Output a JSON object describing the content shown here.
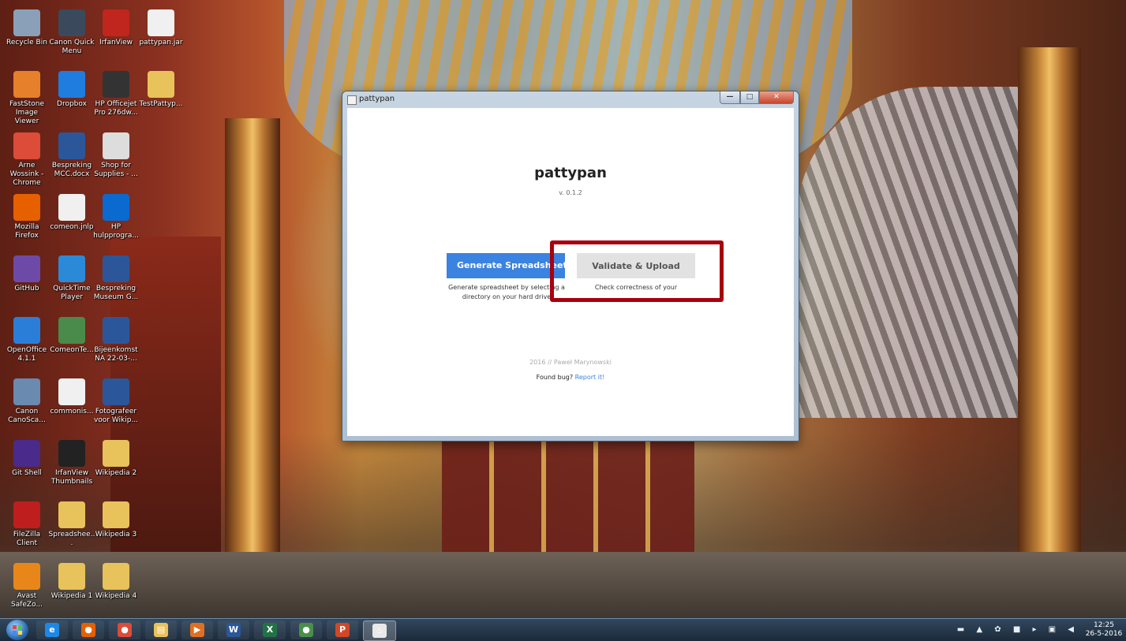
{
  "desktop": {
    "icons": [
      {
        "label": "Recycle Bin",
        "icon": "recycle-bin-icon",
        "color": "#8aa0b8"
      },
      {
        "label": "Canon Quick Menu",
        "icon": "canon-quick-menu-icon",
        "color": "#3a4a5c"
      },
      {
        "label": "IrfanView",
        "icon": "irfanview-icon",
        "color": "#c0261e"
      },
      {
        "label": "pattypan.jar",
        "icon": "java-jar-icon",
        "color": "#f0f0f0"
      },
      {
        "label": "FastStone Image Viewer",
        "icon": "faststone-icon",
        "color": "#e6802a"
      },
      {
        "label": "Dropbox",
        "icon": "dropbox-icon",
        "color": "#1f7de0"
      },
      {
        "label": "HP Officejet Pro 276dw...",
        "icon": "printer-icon",
        "color": "#333333"
      },
      {
        "label": "TestPattyp...",
        "icon": "folder-icon",
        "color": "#e8c25a"
      },
      {
        "label": "Arne Wossink - Chrome",
        "icon": "chrome-icon",
        "color": "#dd4b39"
      },
      {
        "label": "Bespreking MCC.docx",
        "icon": "word-doc-icon",
        "color": "#2b579a"
      },
      {
        "label": "Shop for Supplies - ...",
        "icon": "printer-shop-icon",
        "color": "#dddddd"
      },
      {
        "label": "Mozilla Firefox",
        "icon": "firefox-icon",
        "color": "#e66000"
      },
      {
        "label": "comeon.jnlp",
        "icon": "java-icon",
        "color": "#f0f0f0"
      },
      {
        "label": "HP hulpprogra...",
        "icon": "hp-icon",
        "color": "#0a6ad0"
      },
      {
        "label": "GitHub",
        "icon": "github-icon",
        "color": "#6e4aa8"
      },
      {
        "label": "QuickTime Player",
        "icon": "quicktime-icon",
        "color": "#2a8ad8"
      },
      {
        "label": "Bespreking Museum G...",
        "icon": "word-doc-icon",
        "color": "#2b579a"
      },
      {
        "label": "OpenOffice 4.1.1",
        "icon": "openoffice-icon",
        "color": "#2a7ed8"
      },
      {
        "label": "ComeonTe...",
        "icon": "text-file-icon",
        "color": "#4a8a4a"
      },
      {
        "label": "Bijeenkomst NA 22-03-...",
        "icon": "word-doc-icon",
        "color": "#2b579a"
      },
      {
        "label": "Canon CanoSca...",
        "icon": "canon-scan-icon",
        "color": "#6a8ab0"
      },
      {
        "label": "commonis...",
        "icon": "java-icon",
        "color": "#f0f0f0"
      },
      {
        "label": "Fotografeer voor Wikip...",
        "icon": "word-doc-icon",
        "color": "#2b579a"
      },
      {
        "label": "Git Shell",
        "icon": "git-shell-icon",
        "color": "#4a2a8a"
      },
      {
        "label": "IrfanView Thumbnails",
        "icon": "irfanview-thumbnails-icon",
        "color": "#222222"
      },
      {
        "label": "Wikipedia 2",
        "icon": "folder-icon",
        "color": "#e8c25a"
      },
      {
        "label": "FileZilla Client",
        "icon": "filezilla-icon",
        "color": "#bf1e1e"
      },
      {
        "label": "Spreadshee...",
        "icon": "folder-icon",
        "color": "#e8c25a"
      },
      {
        "label": "Wikipedia 3",
        "icon": "folder-icon",
        "color": "#e8c25a"
      },
      {
        "label": "Avast SafeZo...",
        "icon": "avast-icon",
        "color": "#e8861a"
      },
      {
        "label": "Wikipedia 1",
        "icon": "folder-icon",
        "color": "#e8c25a"
      },
      {
        "label": "Wikipedia 4",
        "icon": "folder-icon",
        "color": "#e8c25a"
      }
    ]
  },
  "window": {
    "title": "pattypan",
    "controls": {
      "minimize": "—",
      "maximize": "□",
      "close": "✕"
    }
  },
  "app": {
    "title": "pattypan",
    "version": "v. 0.1.2",
    "generate": {
      "label": "Generate Spreadsheet",
      "description": "Generate spreadsheet by selecting a directory on your hard drive"
    },
    "validate": {
      "label": "Validate & Upload",
      "description": "Check correctness of your"
    },
    "footer": {
      "credit": "2016 // Paweł Marynowski",
      "bug_prefix": "Found bug?",
      "bug_link": "Report it!"
    },
    "accent": "#3b83e0"
  },
  "annotation": {
    "highlight_color": "#a8000e"
  },
  "taskbar": {
    "items": [
      {
        "icon": "internet-explorer-icon",
        "glyph": "e",
        "color": "#1e88e5"
      },
      {
        "icon": "firefox-icon",
        "glyph": "●",
        "color": "#e66000"
      },
      {
        "icon": "chrome-icon",
        "glyph": "●",
        "color": "#dd4b39"
      },
      {
        "icon": "file-explorer-icon",
        "glyph": "▤",
        "color": "#e8c25a"
      },
      {
        "icon": "media-player-icon",
        "glyph": "▶",
        "color": "#e07020"
      },
      {
        "icon": "word-icon",
        "glyph": "W",
        "color": "#2b579a"
      },
      {
        "icon": "excel-icon",
        "glyph": "X",
        "color": "#217346"
      },
      {
        "icon": "chrome-icon",
        "glyph": "●",
        "color": "#4a8f4a"
      },
      {
        "icon": "powerpoint-icon",
        "glyph": "P",
        "color": "#d24726"
      },
      {
        "icon": "java-icon",
        "glyph": "♨",
        "color": "#e8e8e8"
      }
    ],
    "clock_time": "12:25",
    "clock_date": "26-5-2016"
  }
}
